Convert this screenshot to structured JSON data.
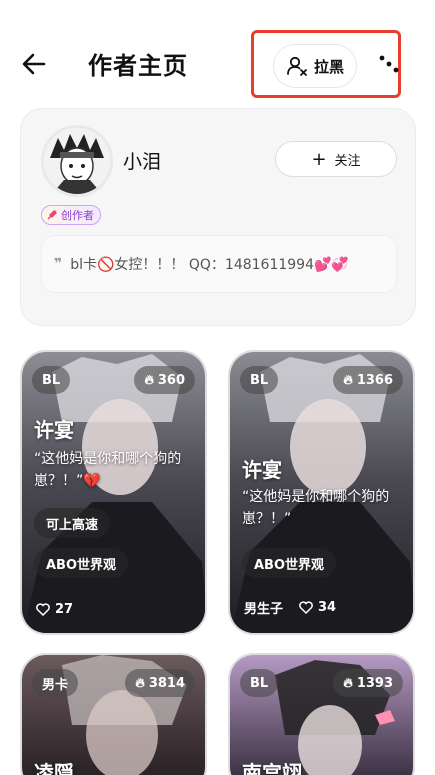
{
  "header": {
    "title": "作者主页",
    "block_label": "拉黑"
  },
  "profile": {
    "username": "小泪",
    "badge": "创作者",
    "follow_label": "关注",
    "bio": "bl卡🚫女控！！！ QQ：1481611994💕💞"
  },
  "cards": [
    {
      "tag": "BL",
      "heat": "360",
      "name": "许宴",
      "quote": "“这他妈是你和哪个狗的崽？！”💔",
      "chips": [
        "可上高速",
        "ABO世界观"
      ],
      "footer_tag": "",
      "likes": "27"
    },
    {
      "tag": "BL",
      "heat": "1366",
      "name": "许宴",
      "quote": "“这他妈是你和哪个狗的崽？！”",
      "chips": [
        "ABO世界观"
      ],
      "footer_tag": "男生子",
      "likes": "34"
    },
    {
      "tag": "男卡",
      "heat": "3814",
      "name": "凌隠",
      "quote": "",
      "chips": [],
      "footer_tag": "",
      "likes": ""
    },
    {
      "tag": "BL",
      "heat": "1393",
      "name": "南宫翊",
      "quote": "",
      "chips": [],
      "footer_tag": "",
      "likes": ""
    }
  ],
  "colors": {
    "annotation_red": "#e53e2a",
    "badge_purple": "#8a3fd6"
  }
}
